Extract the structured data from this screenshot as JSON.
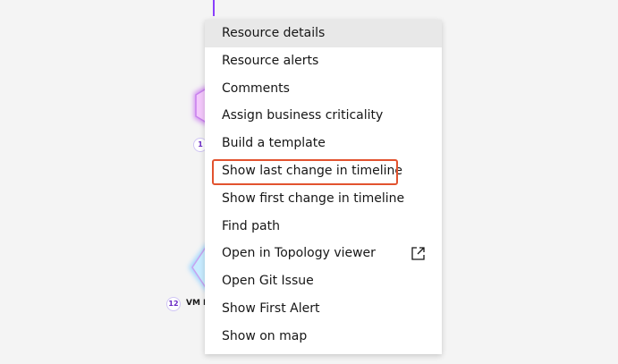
{
  "topology": {
    "node1": {
      "badge": "1",
      "color": "#e8b4f8"
    },
    "node2": {
      "badge": "12",
      "label": "VM D",
      "color": "#b8e4ff"
    }
  },
  "menu": {
    "items": [
      {
        "label": "Resource details",
        "selected": true
      },
      {
        "label": "Resource alerts"
      },
      {
        "label": "Comments"
      },
      {
        "label": "Assign business criticality"
      },
      {
        "label": "Build a template"
      },
      {
        "label": "Show last change in timeline",
        "highlighted": true
      },
      {
        "label": "Show first change in timeline"
      },
      {
        "label": "Find path"
      },
      {
        "label": "Open in Topology viewer",
        "icon": "launch-icon"
      },
      {
        "label": "Open Git Issue"
      },
      {
        "label": "Show First Alert"
      },
      {
        "label": "Show on map"
      }
    ]
  }
}
